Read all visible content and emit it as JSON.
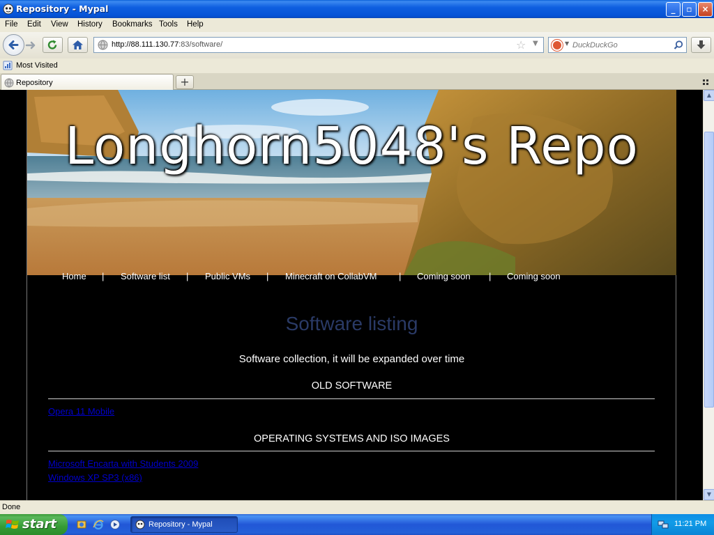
{
  "window": {
    "title": "Repository - Mypal"
  },
  "menu": {
    "items": [
      "File",
      "Edit",
      "View",
      "History",
      "Bookmarks",
      "Tools",
      "Help"
    ]
  },
  "toolbar": {
    "url_host": "http://88.111.130.77",
    "url_rest": ":83/software/",
    "search_placeholder": "DuckDuckGo"
  },
  "bookmarks": {
    "most_visited": "Most Visited"
  },
  "tabs": [
    {
      "label": "Repository"
    }
  ],
  "page": {
    "site_title": "Longhorn5048's Repo",
    "nav": [
      "Home",
      "Software list",
      "Public VMs",
      "Minecraft on CollabVM",
      "Coming soon",
      "Coming soon"
    ],
    "heading": "Software listing",
    "subtitle": "Software collection, it will be expanded over time",
    "sections": [
      {
        "title": "OLD SOFTWARE",
        "links": [
          "Opera 11 Mobile"
        ]
      },
      {
        "title": "OPERATING SYSTEMS AND ISO IMAGES",
        "links": [
          "Microsoft Encarta with Students 2009",
          "Windows XP SP3 (x86)"
        ]
      }
    ]
  },
  "status": {
    "text": "Done"
  },
  "taskbar": {
    "start_label": "start",
    "task_label": "Repository - Mypal",
    "clock": "11:21 PM"
  },
  "colors": {
    "link": "#0000cc",
    "heading": "#2a3a66",
    "titlebar": "#0553d6"
  }
}
